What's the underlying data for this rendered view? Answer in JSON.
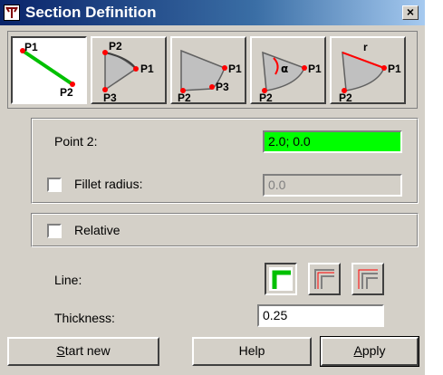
{
  "window": {
    "title": "Section Definition",
    "close_glyph": "×"
  },
  "toolbar": {
    "items": [
      {
        "name": "line-tool",
        "labels": [
          "P1",
          "P2"
        ],
        "active": true
      },
      {
        "name": "arc-3-points-tool",
        "labels": [
          "P2",
          "P1",
          "P3"
        ]
      },
      {
        "name": "arc-center-tool",
        "labels": [
          "P1",
          "P2",
          "P3"
        ]
      },
      {
        "name": "arc-angle-tool",
        "labels": [
          "α",
          "P1",
          "P2"
        ]
      },
      {
        "name": "arc-radius-tool",
        "labels": [
          "r",
          "P1",
          "P2"
        ]
      }
    ]
  },
  "point_group": {
    "point2_label": "Point 2:",
    "point2_value": "2.0; 0.0",
    "point2_color": "#00ff00",
    "fillet_label": "Fillet radius:",
    "fillet_value": "0.0",
    "fillet_checked": false
  },
  "relative": {
    "label": "Relative",
    "checked": false
  },
  "line": {
    "label": "Line:",
    "styles": [
      "line-style-outer",
      "line-style-center",
      "line-style-inner"
    ],
    "selected": 0
  },
  "thickness": {
    "label": "Thickness:",
    "value": "0.25"
  },
  "buttons": {
    "start_new": {
      "mnemonic": "S",
      "rest": "tart new"
    },
    "help": "Help",
    "apply": {
      "mnemonic": "A",
      "rest": "pply"
    }
  }
}
